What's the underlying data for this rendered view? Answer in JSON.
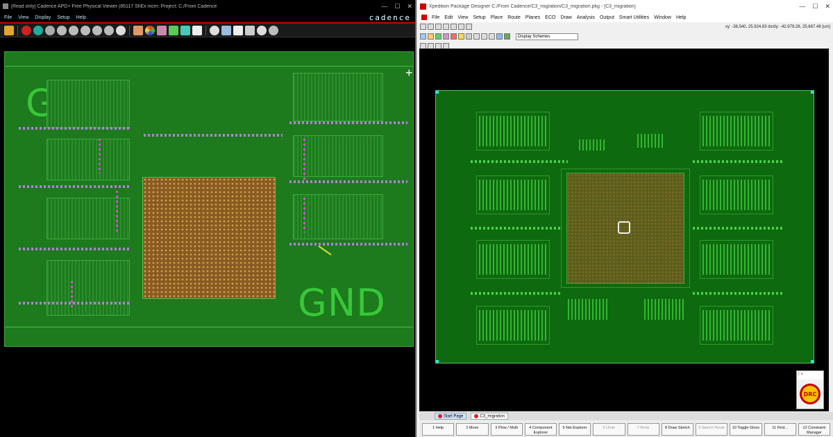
{
  "left": {
    "title": "[Read only] Cadence APD+ Free Physical Viewer (85117 Sl\\Ex mcm: Project: C:/From Cadence",
    "menu": [
      "File",
      "View",
      "Display",
      "Setup",
      "Help"
    ],
    "brand": "cadence",
    "labels": {
      "gnd_top": "GND",
      "gnd_bottom": "GND"
    }
  },
  "right": {
    "title": "Xpedition Package Designer  C:/From Cadence/C3_migration/C3_migration.pkg - [C3_migration]",
    "menu": [
      "File",
      "Edit",
      "View",
      "Setup",
      "Place",
      "Route",
      "Planes",
      "ECO",
      "Draw",
      "Analysis",
      "Output",
      "Smart Utilities",
      "Window",
      "Help"
    ],
    "coords": "xy: -38,540, 25,924.83  dx/dy: -42,979.28, 25,667.48  [um]",
    "scheme": "Display Schemes",
    "tabs": [
      "Start Page",
      "C3_migration"
    ],
    "fkeys": [
      "1 Help",
      "2 Move",
      "3 Plow / Multi",
      "4 Component Explorer",
      "5 Net Explorer",
      "6 Undo",
      "7 Redo",
      "8 Draw Sketch",
      "9 Sketch Route",
      "10 Toggle Gloss",
      "11 Find...",
      "12 Constraint Manager"
    ],
    "drc_title": "! ×",
    "drc_label": "DRC"
  },
  "colors": {
    "board_green": "#1d7a1d",
    "accent_red": "#cc0000",
    "chip_copper": "#8a5a22"
  }
}
